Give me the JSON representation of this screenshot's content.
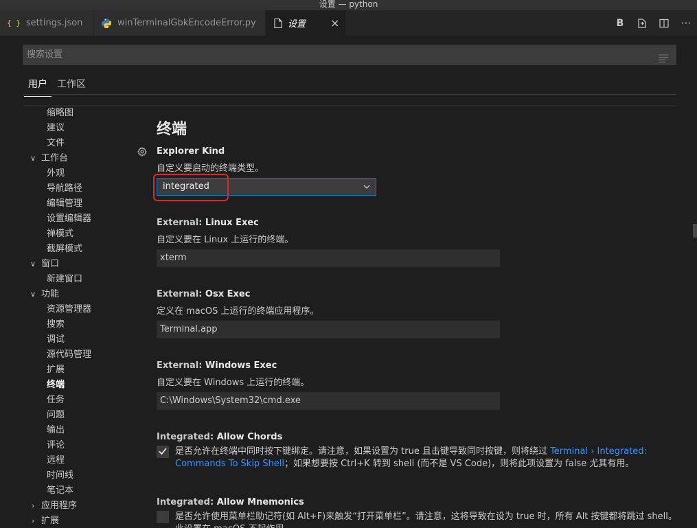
{
  "window": {
    "title": "设置 — python"
  },
  "tabs": [
    {
      "label": "settings.json",
      "icon": "json-braces-icon"
    },
    {
      "label": "winTerminalGbkEncodeError.py",
      "icon": "python-icon"
    },
    {
      "label": "设置",
      "icon": "file-icon",
      "active": true,
      "close": "×"
    }
  ],
  "actions": {
    "b_label": "B",
    "more": "···"
  },
  "search": {
    "placeholder": "搜索设置"
  },
  "scope_tabs": [
    "用户",
    "工作区"
  ],
  "toc": [
    {
      "label": "缩略图",
      "level": 2
    },
    {
      "label": "建议",
      "level": 2
    },
    {
      "label": "文件",
      "level": 2
    },
    {
      "label": "工作台",
      "level": 1,
      "expanded": true
    },
    {
      "label": "外观",
      "level": 2
    },
    {
      "label": "导航路径",
      "level": 2
    },
    {
      "label": "编辑管理",
      "level": 2
    },
    {
      "label": "设置编辑器",
      "level": 2
    },
    {
      "label": "禅模式",
      "level": 2
    },
    {
      "label": "截屏模式",
      "level": 2
    },
    {
      "label": "窗口",
      "level": 1,
      "expanded": true
    },
    {
      "label": "新建窗口",
      "level": 2
    },
    {
      "label": "功能",
      "level": 1,
      "expanded": true
    },
    {
      "label": "资源管理器",
      "level": 2
    },
    {
      "label": "搜索",
      "level": 2
    },
    {
      "label": "调试",
      "level": 2
    },
    {
      "label": "源代码管理",
      "level": 2
    },
    {
      "label": "扩展",
      "level": 2
    },
    {
      "label": "终端",
      "level": 2,
      "active": true
    },
    {
      "label": "任务",
      "level": 2
    },
    {
      "label": "问题",
      "level": 2
    },
    {
      "label": "输出",
      "level": 2
    },
    {
      "label": "评论",
      "level": 2
    },
    {
      "label": "远程",
      "level": 2
    },
    {
      "label": "时间线",
      "level": 2
    },
    {
      "label": "笔记本",
      "level": 2
    },
    {
      "label": "应用程序",
      "level": 1,
      "expanded": false
    },
    {
      "label": "扩展",
      "level": 1,
      "expanded": false
    }
  ],
  "section": {
    "title": "终端"
  },
  "settings": {
    "explorer_kind": {
      "name": "Explorer Kind",
      "desc": "自定义要启动的终端类型。",
      "value": "integrated"
    },
    "linux_exec": {
      "category": "External: ",
      "name": "Linux Exec",
      "desc": "自定义要在 Linux 上运行的终端。",
      "value": "xterm"
    },
    "osx_exec": {
      "category": "External: ",
      "name": "Osx Exec",
      "desc": "定义在 macOS 上运行的终端应用程序。",
      "value": "Terminal.app"
    },
    "windows_exec": {
      "category": "External: ",
      "name": "Windows Exec",
      "desc": "自定义要在 Windows 上运行的终端。",
      "value": "C:\\Windows\\System32\\cmd.exe"
    },
    "allow_chords": {
      "category": "Integrated: ",
      "name": "Allow Chords",
      "checked": true,
      "desc_before": "是否允许在终端中同时按下键绑定。请注意，如果设置为 true 且击键导致同时按键，则将绕过 ",
      "link": "Terminal › Integrated: Commands To Skip Shell",
      "desc_after": "；如果想要按 Ctrl+K 转到 shell (而不是 VS Code)，则将此项设置为 false 尤其有用。"
    },
    "allow_mnemonics": {
      "category": "Integrated: ",
      "name": "Allow Mnemonics",
      "checked": false,
      "desc": "是否允许使用菜单栏助记符(如 Alt+F)来触发“打开菜单栏”。请注意，这将导致在设为 true 时，所有 Alt 按键都将跳过 shell。此设置在 macOS 不起作用。"
    }
  },
  "colors": {
    "accent": "#007fd4",
    "link": "#3794ff",
    "highlight": "#e0262d",
    "background": "#1e1e1e"
  }
}
